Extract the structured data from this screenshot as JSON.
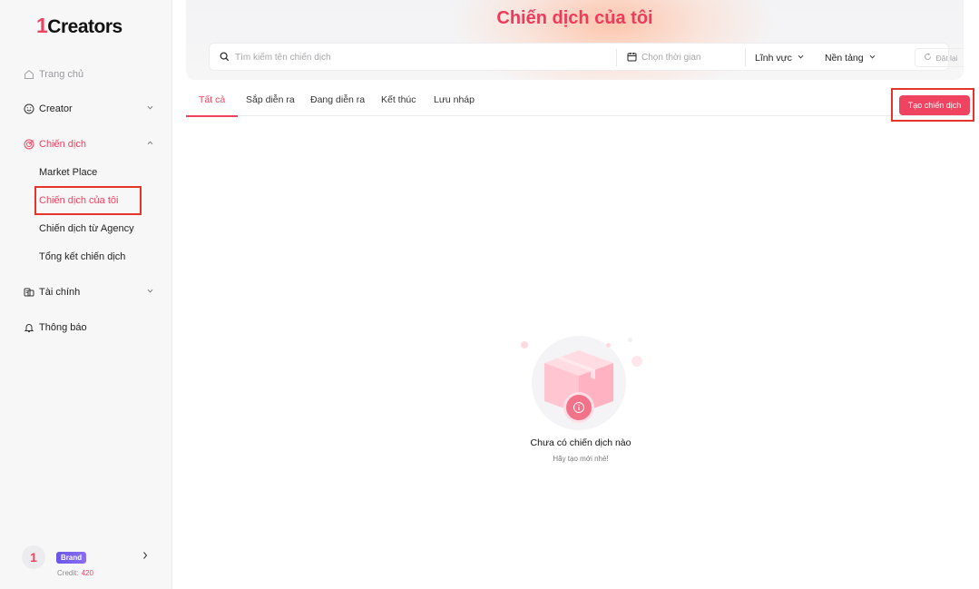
{
  "colors": {
    "accent": "#f0435f",
    "highlight_border": "#e5352b",
    "brand_badge": "#6a56e6"
  },
  "logo": {
    "one": "1",
    "text": "Creators"
  },
  "sidebar": {
    "items": [
      {
        "label": "Trang chủ",
        "icon": "home-icon"
      },
      {
        "label": "Creator",
        "icon": "smile-icon"
      },
      {
        "label": "Chiến dịch",
        "icon": "target-icon"
      },
      {
        "label": "Tài chính",
        "icon": "wallet-icon"
      },
      {
        "label": "Thông báo",
        "icon": "bell-icon"
      }
    ],
    "campaign_sub": [
      "Market Place",
      "Chiến dịch của tôi",
      "Chiến dịch từ Agency",
      "Tổng kết chiến dịch"
    ]
  },
  "user": {
    "avatar": "1",
    "badge": "Brand",
    "credit_label": "Credit:",
    "credit_value": "420"
  },
  "header": {
    "title": "Chiến dịch của tôi",
    "search_placeholder": "Tìm kiếm tên chiến dịch",
    "date_placeholder": "Chọn thời gian",
    "field_label": "Lĩnh vực",
    "platform_label": "Nền tảng",
    "reset_label": "Đặt lại"
  },
  "tabs": [
    "Tất cả",
    "Sắp diễn ra",
    "Đang diễn ra",
    "Kết thúc",
    "Lưu nháp"
  ],
  "create_button": "Tạo chiến dịch",
  "empty": {
    "title": "Chưa có chiến dịch nào",
    "subtitle": "Hãy tạo mới nhé!"
  }
}
